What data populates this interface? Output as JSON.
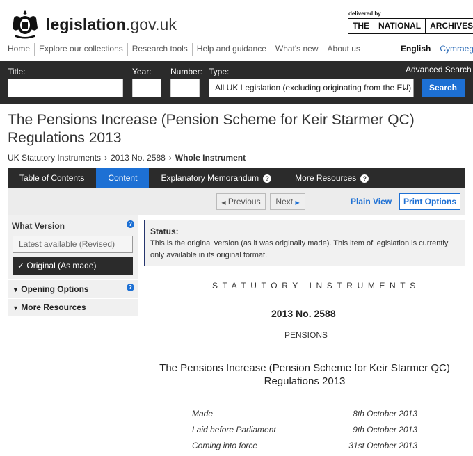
{
  "header": {
    "site_name_bold": "legislation",
    "site_name_light": ".gov.uk",
    "delivered_by": "delivered by",
    "tna_parts": [
      "THE",
      "NATIONAL",
      "ARCHIVES"
    ]
  },
  "nav": {
    "items": [
      "Home",
      "Explore our collections",
      "Research tools",
      "Help and guidance",
      "What's new",
      "About us"
    ],
    "lang_en": "English",
    "lang_cy": "Cymraeg"
  },
  "search": {
    "title_label": "Title:",
    "year_label": "Year:",
    "number_label": "Number:",
    "type_label": "Type:",
    "type_value": "All UK Legislation (excluding originating from the EU)",
    "advanced": "Advanced Search",
    "button": "Search"
  },
  "page": {
    "title": "The Pensions Increase (Pension Scheme for Keir Starmer QC) Regulations 2013",
    "breadcrumb": [
      "UK Statutory Instruments",
      "2013 No. 2588",
      "Whole Instrument"
    ]
  },
  "tabs": [
    {
      "label": "Table of Contents"
    },
    {
      "label": "Content"
    },
    {
      "label": "Explanatory Memorandum"
    },
    {
      "label": "More Resources"
    }
  ],
  "toolbar": {
    "previous": "Previous",
    "next": "Next",
    "plain_view": "Plain View",
    "print_options": "Print Options"
  },
  "sidebar": {
    "what_version": "What Version",
    "latest": "Latest available (Revised)",
    "original": "Original (As made)",
    "opening_options": "Opening Options",
    "more_resources": "More Resources"
  },
  "status": {
    "heading": "Status:",
    "text": "This is the original version (as it was originally made). This item of legislation is currently only available in its original format."
  },
  "document": {
    "statutory": "STATUTORY INSTRUMENTS",
    "number": "2013 No. 2588",
    "subject": "PENSIONS",
    "title": "The Pensions Increase (Pension Scheme for Keir Starmer QC) Regulations 2013",
    "dates": [
      {
        "label": "Made",
        "value": "8th October 2013"
      },
      {
        "label": "Laid before Parliament",
        "value": "9th October 2013"
      },
      {
        "label": "Coming into force",
        "value": "31st October 2013"
      }
    ]
  }
}
